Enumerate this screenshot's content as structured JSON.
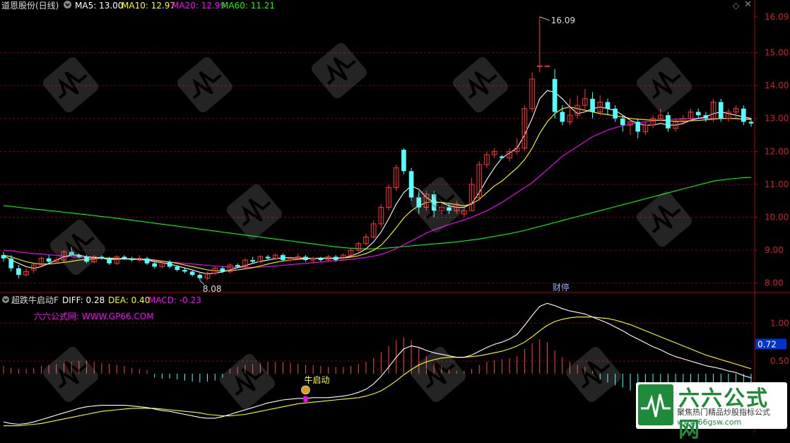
{
  "header": {
    "title": "道恩股份(日线)",
    "ma5": "MA5: 13.00",
    "ma10": "MA10: 12.97",
    "ma20": "MA20: 12.99",
    "ma60": "MA60: 11.21",
    "colors": {
      "ma5": "#ffffff",
      "ma10": "#ffff00",
      "ma20": "#ff00ff",
      "ma60": "#00ff00"
    }
  },
  "indicator": {
    "name": "超跌牛启动F",
    "diff": "DIFF: 0.28",
    "dea": "DEA: 0.40",
    "macd": "MACD: -0.23",
    "site": "六六公式网: WWW.GP66.COM",
    "signal_label": "牛启动"
  },
  "main_axis": {
    "ticks": [
      "16.09",
      "15.00",
      "14.00",
      "13.00",
      "12.00",
      "11.00",
      "10.00",
      "9.00",
      "8.00"
    ]
  },
  "sub_axis": {
    "ticks": [
      "1.00",
      "0.50"
    ],
    "current": "0.72"
  },
  "annotations": {
    "high": "16.09",
    "low": "8.08",
    "event": "财停"
  },
  "watermark": {
    "brand": "六六公式网",
    "slogan": "聚焦热门精品炒股指标公式",
    "url": "www.66gsw.com"
  },
  "chart_data": {
    "type": "candlestick",
    "ylim_main": [
      7.8,
      16.3
    ],
    "ylim_sub": [
      -0.4,
      1.3
    ],
    "candles": [
      [
        8.85,
        8.75,
        8.95,
        8.65
      ],
      [
        8.75,
        8.45,
        8.85,
        8.35
      ],
      [
        8.45,
        8.25,
        8.55,
        8.15
      ],
      [
        8.25,
        8.35,
        8.45,
        8.2
      ],
      [
        8.4,
        8.55,
        8.6,
        8.3
      ],
      [
        8.55,
        8.75,
        8.8,
        8.5
      ],
      [
        8.75,
        8.65,
        8.85,
        8.6
      ],
      [
        8.65,
        8.7,
        8.8,
        8.6
      ],
      [
        8.7,
        8.95,
        9.0,
        8.65
      ],
      [
        8.95,
        8.85,
        9.1,
        8.8
      ],
      [
        8.85,
        8.8,
        8.9,
        8.75
      ],
      [
        8.8,
        8.65,
        8.85,
        8.6
      ],
      [
        8.65,
        8.8,
        8.85,
        8.6
      ],
      [
        8.8,
        8.75,
        8.85,
        8.7
      ],
      [
        8.75,
        8.6,
        8.8,
        8.55
      ],
      [
        8.6,
        8.8,
        8.85,
        8.55
      ],
      [
        8.8,
        8.75,
        8.85,
        8.7
      ],
      [
        8.75,
        8.7,
        8.8,
        8.65
      ],
      [
        8.7,
        8.75,
        8.85,
        8.65
      ],
      [
        8.75,
        8.6,
        8.8,
        8.55
      ],
      [
        8.6,
        8.5,
        8.65,
        8.45
      ],
      [
        8.5,
        8.65,
        8.7,
        8.45
      ],
      [
        8.65,
        8.5,
        8.7,
        8.45
      ],
      [
        8.5,
        8.4,
        8.55,
        8.35
      ],
      [
        8.4,
        8.35,
        8.45,
        8.3
      ],
      [
        8.35,
        8.25,
        8.4,
        8.2
      ],
      [
        8.25,
        8.15,
        8.3,
        8.08
      ],
      [
        8.15,
        8.3,
        8.35,
        8.1
      ],
      [
        8.3,
        8.45,
        8.5,
        8.25
      ],
      [
        8.45,
        8.35,
        8.5,
        8.3
      ],
      [
        8.35,
        8.55,
        8.6,
        8.3
      ],
      [
        8.55,
        8.5,
        8.6,
        8.45
      ],
      [
        8.5,
        8.7,
        8.75,
        8.45
      ],
      [
        8.7,
        8.65,
        8.8,
        8.6
      ],
      [
        8.65,
        8.8,
        8.85,
        8.6
      ],
      [
        8.8,
        8.75,
        8.85,
        8.7
      ],
      [
        8.75,
        8.85,
        8.9,
        8.7
      ],
      [
        8.85,
        8.7,
        8.9,
        8.65
      ],
      [
        8.7,
        8.75,
        8.8,
        8.65
      ],
      [
        8.75,
        8.8,
        8.9,
        8.7
      ],
      [
        8.8,
        8.7,
        8.85,
        8.65
      ],
      [
        8.7,
        8.75,
        8.8,
        8.6
      ],
      [
        8.75,
        8.7,
        8.8,
        8.65
      ],
      [
        8.7,
        8.8,
        8.85,
        8.65
      ],
      [
        8.8,
        8.7,
        8.85,
        8.65
      ],
      [
        8.7,
        8.85,
        8.9,
        8.7
      ],
      [
        8.85,
        9.0,
        9.05,
        8.8
      ],
      [
        9.0,
        9.2,
        9.25,
        8.95
      ],
      [
        9.2,
        9.4,
        9.5,
        9.15
      ],
      [
        9.4,
        9.8,
        9.9,
        9.35
      ],
      [
        9.8,
        10.3,
        10.4,
        9.7
      ],
      [
        10.3,
        10.9,
        11.0,
        10.2
      ],
      [
        10.9,
        11.5,
        11.6,
        10.8
      ],
      [
        12.05,
        11.4,
        12.1,
        11.3
      ],
      [
        11.4,
        10.6,
        11.5,
        10.5
      ],
      [
        10.6,
        10.3,
        10.8,
        10.1
      ],
      [
        10.3,
        10.7,
        10.8,
        10.2
      ],
      [
        10.7,
        10.2,
        10.8,
        10.0
      ],
      [
        10.2,
        10.3,
        10.4,
        10.1
      ],
      [
        10.3,
        10.2,
        10.4,
        10.1
      ],
      [
        10.2,
        10.4,
        10.5,
        10.1
      ],
      [
        10.1,
        10.2,
        10.3,
        10.0
      ],
      [
        10.2,
        11.0,
        11.2,
        10.2
      ],
      [
        10.6,
        11.6,
        11.7,
        10.5
      ],
      [
        11.6,
        11.9,
        12.0,
        11.5
      ],
      [
        11.9,
        12.0,
        12.1,
        11.8
      ],
      [
        11.85,
        11.8,
        11.9,
        11.8
      ],
      [
        11.8,
        12.0,
        12.1,
        11.7
      ],
      [
        12.0,
        12.1,
        12.4,
        11.9
      ],
      [
        12.1,
        13.3,
        13.4,
        12.0
      ],
      [
        13.3,
        14.2,
        14.4,
        13.2
      ],
      [
        14.6,
        14.6,
        16.09,
        14.4
      ],
      [
        14.6,
        14.6,
        14.6,
        14.6
      ],
      [
        14.2,
        13.2,
        14.5,
        13.0
      ],
      [
        13.2,
        12.9,
        13.4,
        12.8
      ],
      [
        12.9,
        13.1,
        13.6,
        12.8
      ],
      [
        13.1,
        13.4,
        13.7,
        13.0
      ],
      [
        13.4,
        13.6,
        13.9,
        13.2
      ],
      [
        13.6,
        13.2,
        13.8,
        13.0
      ],
      [
        13.2,
        13.5,
        13.7,
        13.1
      ],
      [
        13.5,
        13.3,
        13.6,
        13.1
      ],
      [
        13.3,
        13.0,
        13.4,
        12.9
      ],
      [
        13.0,
        12.8,
        13.1,
        12.6
      ],
      [
        12.8,
        12.9,
        13.0,
        12.5
      ],
      [
        12.9,
        12.6,
        13.0,
        12.4
      ],
      [
        12.6,
        12.8,
        12.9,
        12.5
      ],
      [
        12.8,
        13.0,
        13.1,
        12.7
      ],
      [
        13.0,
        13.1,
        13.3,
        12.9
      ],
      [
        13.1,
        12.7,
        13.2,
        12.6
      ],
      [
        12.7,
        12.9,
        13.0,
        12.6
      ],
      [
        12.9,
        13.0,
        13.1,
        12.8
      ],
      [
        13.0,
        13.2,
        13.3,
        12.9
      ],
      [
        13.2,
        13.1,
        13.3,
        13.0
      ],
      [
        13.1,
        13.0,
        13.2,
        12.9
      ],
      [
        13.0,
        13.5,
        13.6,
        12.9
      ],
      [
        13.5,
        13.0,
        13.6,
        12.9
      ],
      [
        13.0,
        13.2,
        13.3,
        12.9
      ],
      [
        13.2,
        13.3,
        13.4,
        13.0
      ],
      [
        13.3,
        12.9,
        13.4,
        12.8
      ],
      [
        12.9,
        12.85,
        13.0,
        12.75
      ]
    ],
    "ma5": [
      8.85,
      8.7,
      8.6,
      8.5,
      8.45,
      8.5,
      8.6,
      8.7,
      8.8,
      8.85,
      8.85,
      8.8,
      8.78,
      8.76,
      8.72,
      8.72,
      8.74,
      8.73,
      8.72,
      8.7,
      8.65,
      8.62,
      8.58,
      8.52,
      8.46,
      8.4,
      8.33,
      8.28,
      8.3,
      8.34,
      8.4,
      8.47,
      8.53,
      8.6,
      8.66,
      8.7,
      8.74,
      8.77,
      8.77,
      8.76,
      8.76,
      8.75,
      8.75,
      8.75,
      8.75,
      8.77,
      8.82,
      8.91,
      9.04,
      9.25,
      9.55,
      9.95,
      10.4,
      10.75,
      10.95,
      10.85,
      10.6,
      10.45,
      10.45,
      10.35,
      10.3,
      10.3,
      10.42,
      10.75,
      11.15,
      11.5,
      11.8,
      11.95,
      12.1,
      12.5,
      13.0,
      13.6,
      13.85,
      13.8,
      13.6,
      13.35,
      13.15,
      13.2,
      13.3,
      13.35,
      13.3,
      13.25,
      13.1,
      12.95,
      12.85,
      12.8,
      12.8,
      12.85,
      12.8,
      12.8,
      12.85,
      12.95,
      13.0,
      13.05,
      13.15,
      13.2,
      13.15,
      13.1,
      13.05,
      13.0
    ],
    "ma10": [
      8.85,
      8.8,
      8.72,
      8.65,
      8.6,
      8.58,
      8.58,
      8.6,
      8.63,
      8.66,
      8.7,
      8.72,
      8.74,
      8.76,
      8.76,
      8.75,
      8.74,
      8.74,
      8.73,
      8.72,
      8.7,
      8.67,
      8.64,
      8.6,
      8.55,
      8.5,
      8.45,
      8.4,
      8.38,
      8.37,
      8.38,
      8.4,
      8.43,
      8.47,
      8.52,
      8.58,
      8.63,
      8.67,
      8.7,
      8.72,
      8.74,
      8.75,
      8.76,
      8.76,
      8.76,
      8.77,
      8.79,
      8.83,
      8.9,
      9.0,
      9.15,
      9.4,
      9.68,
      9.98,
      10.2,
      10.35,
      10.45,
      10.47,
      10.45,
      10.42,
      10.38,
      10.35,
      10.4,
      10.55,
      10.75,
      10.95,
      11.1,
      11.3,
      11.5,
      11.75,
      12.1,
      12.55,
      12.9,
      13.15,
      13.3,
      13.35,
      13.3,
      13.25,
      13.2,
      13.15,
      13.12,
      13.08,
      13.05,
      13.0,
      12.98,
      12.96,
      12.95,
      12.95,
      12.93,
      12.92,
      12.92,
      12.93,
      12.94,
      12.96,
      12.98,
      13.0,
      13.0,
      13.0,
      12.98,
      12.97
    ],
    "ma20": [
      9.0,
      8.98,
      8.95,
      8.92,
      8.9,
      8.88,
      8.86,
      8.84,
      8.82,
      8.8,
      8.79,
      8.78,
      8.77,
      8.76,
      8.75,
      8.74,
      8.73,
      8.72,
      8.71,
      8.7,
      8.68,
      8.66,
      8.64,
      8.62,
      8.6,
      8.58,
      8.56,
      8.54,
      8.52,
      8.5,
      8.49,
      8.48,
      8.48,
      8.48,
      8.49,
      8.5,
      8.52,
      8.54,
      8.56,
      8.58,
      8.6,
      8.62,
      8.64,
      8.66,
      8.68,
      8.7,
      8.72,
      8.75,
      8.78,
      8.82,
      8.87,
      8.95,
      9.05,
      9.16,
      9.28,
      9.4,
      9.52,
      9.62,
      9.7,
      9.78,
      9.85,
      9.92,
      10.0,
      10.1,
      10.2,
      10.32,
      10.45,
      10.6,
      10.75,
      10.9,
      11.05,
      11.25,
      11.45,
      11.65,
      11.85,
      12.0,
      12.15,
      12.3,
      12.45,
      12.55,
      12.65,
      12.72,
      12.78,
      12.83,
      12.87,
      12.9,
      12.93,
      12.95,
      12.97,
      12.98,
      12.99,
      13.0,
      13.0,
      13.0,
      13.0,
      13.0,
      13.0,
      12.99,
      12.99,
      12.99
    ],
    "ma60": [
      10.35,
      10.33,
      10.3,
      10.28,
      10.25,
      10.23,
      10.2,
      10.18,
      10.15,
      10.13,
      10.1,
      10.08,
      10.05,
      10.02,
      10.0,
      9.97,
      9.94,
      9.91,
      9.88,
      9.85,
      9.82,
      9.79,
      9.76,
      9.73,
      9.7,
      9.67,
      9.64,
      9.61,
      9.58,
      9.55,
      9.52,
      9.49,
      9.46,
      9.43,
      9.4,
      9.37,
      9.34,
      9.31,
      9.28,
      9.25,
      9.22,
      9.19,
      9.16,
      9.13,
      9.1,
      9.08,
      9.06,
      9.05,
      9.04,
      9.04,
      9.05,
      9.07,
      9.09,
      9.11,
      9.13,
      9.15,
      9.17,
      9.19,
      9.21,
      9.23,
      9.25,
      9.28,
      9.31,
      9.34,
      9.38,
      9.42,
      9.46,
      9.5,
      9.55,
      9.6,
      9.66,
      9.72,
      9.78,
      9.84,
      9.9,
      9.96,
      10.02,
      10.08,
      10.14,
      10.2,
      10.26,
      10.32,
      10.38,
      10.44,
      10.5,
      10.56,
      10.62,
      10.68,
      10.74,
      10.8,
      10.86,
      10.92,
      10.98,
      11.04,
      11.1,
      11.13,
      11.16,
      11.18,
      11.2,
      11.21
    ],
    "diff": [
      -0.3,
      -0.32,
      -0.33,
      -0.32,
      -0.3,
      -0.27,
      -0.24,
      -0.21,
      -0.18,
      -0.15,
      -0.12,
      -0.1,
      -0.09,
      -0.08,
      -0.08,
      -0.08,
      -0.08,
      -0.09,
      -0.1,
      -0.11,
      -0.13,
      -0.15,
      -0.16,
      -0.18,
      -0.2,
      -0.22,
      -0.24,
      -0.25,
      -0.25,
      -0.23,
      -0.2,
      -0.17,
      -0.14,
      -0.11,
      -0.08,
      -0.05,
      -0.03,
      -0.01,
      0.0,
      0.01,
      0.01,
      0.02,
      0.02,
      0.02,
      0.03,
      0.04,
      0.06,
      0.09,
      0.13,
      0.2,
      0.3,
      0.42,
      0.55,
      0.66,
      0.7,
      0.68,
      0.64,
      0.61,
      0.59,
      0.57,
      0.55,
      0.55,
      0.58,
      0.63,
      0.68,
      0.72,
      0.75,
      0.79,
      0.85,
      0.97,
      1.1,
      1.22,
      1.26,
      1.23,
      1.19,
      1.16,
      1.14,
      1.12,
      1.08,
      1.04,
      1.0,
      0.95,
      0.9,
      0.84,
      0.79,
      0.74,
      0.69,
      0.65,
      0.6,
      0.56,
      0.53,
      0.5,
      0.47,
      0.44,
      0.42,
      0.4,
      0.37,
      0.35,
      0.31,
      0.28
    ],
    "dea": [
      -0.35,
      -0.35,
      -0.35,
      -0.34,
      -0.33,
      -0.32,
      -0.3,
      -0.28,
      -0.26,
      -0.24,
      -0.22,
      -0.2,
      -0.18,
      -0.16,
      -0.15,
      -0.14,
      -0.13,
      -0.12,
      -0.12,
      -0.12,
      -0.12,
      -0.13,
      -0.14,
      -0.15,
      -0.16,
      -0.17,
      -0.18,
      -0.2,
      -0.21,
      -0.22,
      -0.22,
      -0.21,
      -0.2,
      -0.18,
      -0.16,
      -0.14,
      -0.12,
      -0.1,
      -0.08,
      -0.06,
      -0.05,
      -0.04,
      -0.03,
      -0.02,
      -0.01,
      0.0,
      0.01,
      0.02,
      0.04,
      0.07,
      0.11,
      0.17,
      0.24,
      0.32,
      0.39,
      0.45,
      0.49,
      0.52,
      0.54,
      0.55,
      0.55,
      0.55,
      0.56,
      0.57,
      0.59,
      0.61,
      0.63,
      0.66,
      0.7,
      0.75,
      0.82,
      0.9,
      0.97,
      1.02,
      1.05,
      1.07,
      1.08,
      1.08,
      1.08,
      1.07,
      1.06,
      1.04,
      1.01,
      0.98,
      0.94,
      0.9,
      0.86,
      0.82,
      0.78,
      0.74,
      0.7,
      0.66,
      0.62,
      0.58,
      0.55,
      0.52,
      0.49,
      0.46,
      0.43,
      0.4
    ],
    "signal_index": 40
  }
}
